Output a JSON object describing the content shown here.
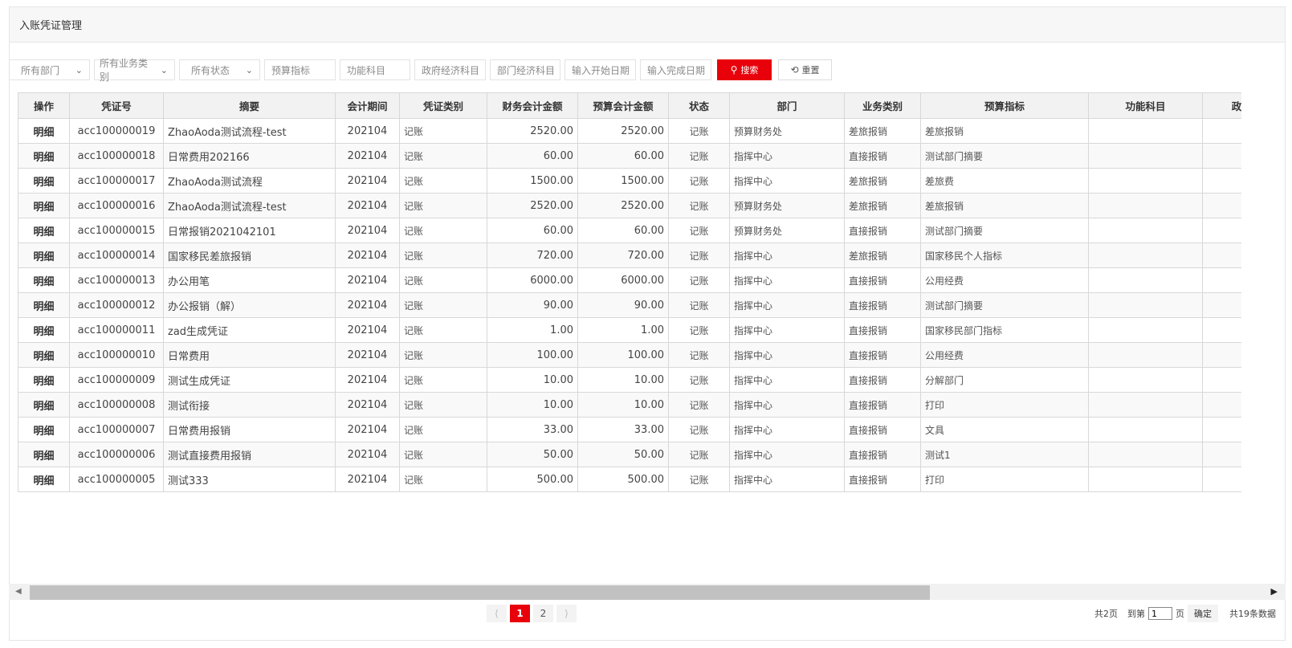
{
  "page_title": "入账凭证管理",
  "filters": {
    "dept_select": "所有部门",
    "biz_select": "所有业务类别",
    "status_select": "所有状态",
    "budget_index_ph": "预算指标",
    "function_subject_ph": "功能科目",
    "gov_econ_ph": "政府经济科目",
    "dept_econ_ph": "部门经济科目",
    "start_date_ph": "输入开始日期",
    "end_date_ph": "输入完成日期",
    "search_label": "搜索",
    "reset_label": "重置"
  },
  "table": {
    "headers": [
      "操作",
      "凭证号",
      "摘要",
      "会计期间",
      "凭证类别",
      "财务会计金额",
      "预算会计金额",
      "状态",
      "部门",
      "业务类别",
      "预算指标",
      "功能科目",
      "政"
    ],
    "rows": [
      [
        "明细",
        "acc100000019",
        "ZhaoAoda测试流程-test",
        "202104",
        "记账",
        "2520.00",
        "2520.00",
        "记账",
        "预算财务处",
        "差旅报销",
        "差旅报销",
        ""
      ],
      [
        "明细",
        "acc100000018",
        "日常费用202166",
        "202104",
        "记账",
        "60.00",
        "60.00",
        "记账",
        "指挥中心",
        "直接报销",
        "测试部门摘要",
        ""
      ],
      [
        "明细",
        "acc100000017",
        "ZhaoAoda测试流程",
        "202104",
        "记账",
        "1500.00",
        "1500.00",
        "记账",
        "指挥中心",
        "差旅报销",
        "差旅费",
        ""
      ],
      [
        "明细",
        "acc100000016",
        "ZhaoAoda测试流程-test",
        "202104",
        "记账",
        "2520.00",
        "2520.00",
        "记账",
        "预算财务处",
        "差旅报销",
        "差旅报销",
        ""
      ],
      [
        "明细",
        "acc100000015",
        "日常报销2021042101",
        "202104",
        "记账",
        "60.00",
        "60.00",
        "记账",
        "预算财务处",
        "直接报销",
        "测试部门摘要",
        ""
      ],
      [
        "明细",
        "acc100000014",
        "国家移民差旅报销",
        "202104",
        "记账",
        "720.00",
        "720.00",
        "记账",
        "指挥中心",
        "差旅报销",
        "国家移民个人指标",
        ""
      ],
      [
        "明细",
        "acc100000013",
        "办公用笔",
        "202104",
        "记账",
        "6000.00",
        "6000.00",
        "记账",
        "指挥中心",
        "直接报销",
        "公用经费",
        ""
      ],
      [
        "明细",
        "acc100000012",
        "办公报销（解）",
        "202104",
        "记账",
        "90.00",
        "90.00",
        "记账",
        "指挥中心",
        "直接报销",
        "测试部门摘要",
        ""
      ],
      [
        "明细",
        "acc100000011",
        "zad生成凭证",
        "202104",
        "记账",
        "1.00",
        "1.00",
        "记账",
        "指挥中心",
        "直接报销",
        "国家移民部门指标",
        ""
      ],
      [
        "明细",
        "acc100000010",
        "日常费用",
        "202104",
        "记账",
        "100.00",
        "100.00",
        "记账",
        "指挥中心",
        "直接报销",
        "公用经费",
        ""
      ],
      [
        "明细",
        "acc100000009",
        "测试生成凭证",
        "202104",
        "记账",
        "10.00",
        "10.00",
        "记账",
        "指挥中心",
        "直接报销",
        "分解部门",
        ""
      ],
      [
        "明细",
        "acc100000008",
        "测试衔接",
        "202104",
        "记账",
        "10.00",
        "10.00",
        "记账",
        "指挥中心",
        "直接报销",
        "打印",
        ""
      ],
      [
        "明细",
        "acc100000007",
        "日常费用报销",
        "202104",
        "记账",
        "33.00",
        "33.00",
        "记账",
        "指挥中心",
        "直接报销",
        "文具",
        ""
      ],
      [
        "明细",
        "acc100000006",
        "测试直接费用报销",
        "202104",
        "记账",
        "50.00",
        "50.00",
        "记账",
        "指挥中心",
        "直接报销",
        "测试1",
        ""
      ],
      [
        "明细",
        "acc100000005",
        "测试333",
        "202104",
        "记账",
        "500.00",
        "500.00",
        "记账",
        "指挥中心",
        "直接报销",
        "打印",
        ""
      ]
    ]
  },
  "pagination": {
    "pages": [
      "1",
      "2"
    ],
    "current": "1",
    "total_pages_text": "共2页",
    "goto_prefix": "到第",
    "goto_value": "1",
    "goto_suffix": "页",
    "confirm_label": "确定",
    "total_records_text": "共19条数据"
  }
}
